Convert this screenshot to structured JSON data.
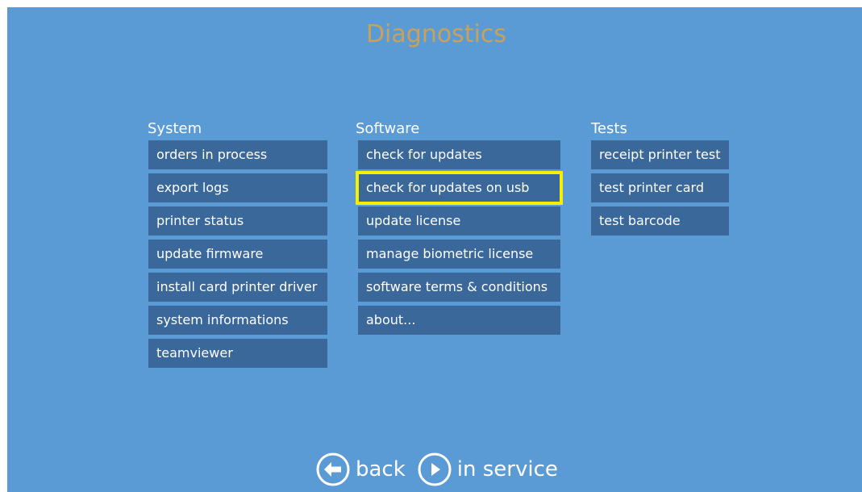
{
  "title": "Diagnostics",
  "columns": {
    "system": {
      "heading": "System",
      "items": [
        "orders in process",
        "export logs",
        "printer status",
        "update firmware",
        "install card printer driver",
        "system informations",
        "teamviewer"
      ]
    },
    "software": {
      "heading": "Software",
      "items": [
        "check for updates",
        "check for updates on usb",
        "update license",
        "manage biometric license",
        "software terms & conditions",
        "about..."
      ]
    },
    "tests": {
      "heading": "Tests",
      "items": [
        "receipt printer test",
        "test printer card",
        "test barcode"
      ]
    }
  },
  "footer": {
    "back_label": "back",
    "back_icon": "arrow-left-circle-icon",
    "service_label": "in service",
    "service_icon": "play-circle-icon"
  },
  "colors": {
    "background": "#5b9bd5",
    "button": "#3b689a",
    "title": "#c9a15a",
    "highlight": "#f6f000"
  }
}
